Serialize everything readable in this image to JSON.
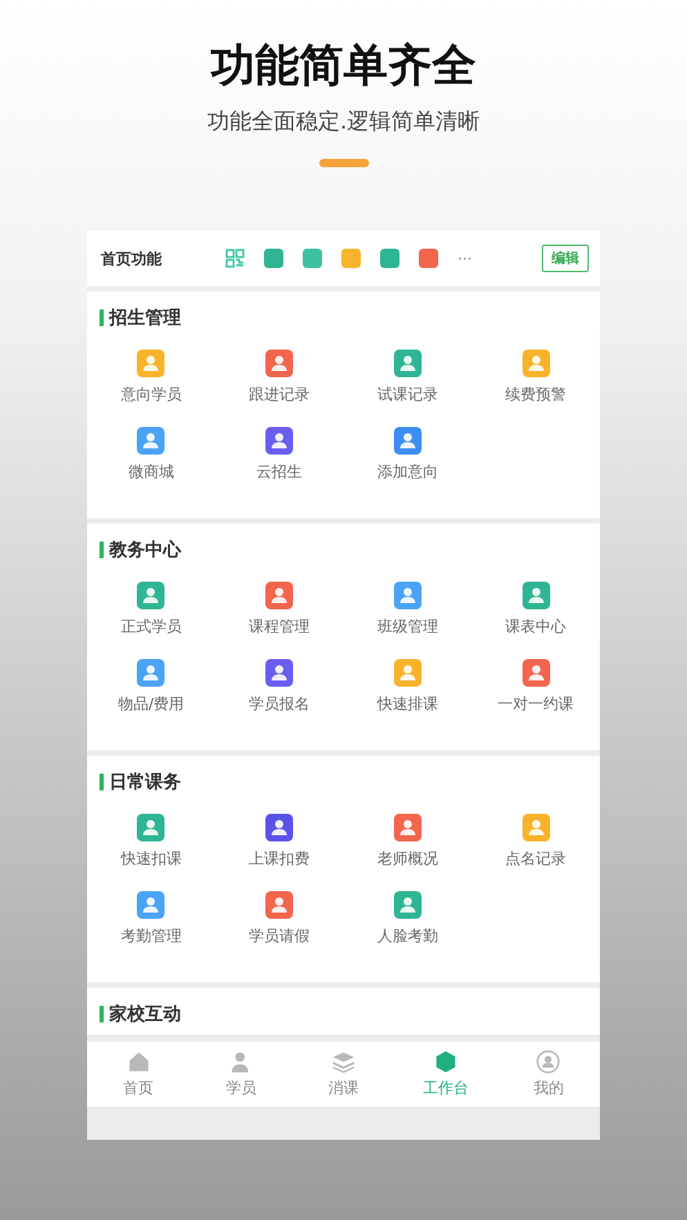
{
  "headline": "功能简单齐全",
  "subtitle": "功能全面稳定.逻辑简单清晰",
  "header": {
    "title": "首页功能",
    "icons": [
      {
        "color": "#3cc9a8",
        "kind": "qr"
      },
      {
        "color": "#2fb593",
        "kind": "tile"
      },
      {
        "color": "#3cc2a0",
        "kind": "tile"
      },
      {
        "color": "#f7b52c",
        "kind": "tile"
      },
      {
        "color": "#2fb593",
        "kind": "tile"
      },
      {
        "color": "#f3654d",
        "kind": "tile"
      }
    ],
    "more": "···",
    "edit_button": "编辑"
  },
  "sections": [
    {
      "title": "招生管理",
      "items": [
        {
          "label": "意向学员",
          "color": "#f9b32a"
        },
        {
          "label": "跟进记录",
          "color": "#f3654d"
        },
        {
          "label": "试课记录",
          "color": "#2fb593"
        },
        {
          "label": "续费预警",
          "color": "#f9b32a"
        },
        {
          "label": "微商城",
          "color": "#4ba3f5"
        },
        {
          "label": "云招生",
          "color": "#6a5ef0"
        },
        {
          "label": "添加意向",
          "color": "#3d8ef2"
        }
      ]
    },
    {
      "title": "教务中心",
      "items": [
        {
          "label": "正式学员",
          "color": "#2fb593"
        },
        {
          "label": "课程管理",
          "color": "#f3654d"
        },
        {
          "label": "班级管理",
          "color": "#4ba3f5"
        },
        {
          "label": "课表中心",
          "color": "#2fb593"
        },
        {
          "label": "物品/费用",
          "color": "#4ba3f5"
        },
        {
          "label": "学员报名",
          "color": "#6a5ef0"
        },
        {
          "label": "快速排课",
          "color": "#f9b32a"
        },
        {
          "label": "一对一约课",
          "color": "#f3654d"
        }
      ]
    },
    {
      "title": "日常课务",
      "items": [
        {
          "label": "快速扣课",
          "color": "#2fb593"
        },
        {
          "label": "上课扣费",
          "color": "#5a52e8"
        },
        {
          "label": "老师概况",
          "color": "#f3654d"
        },
        {
          "label": "点名记录",
          "color": "#f9b32a"
        },
        {
          "label": "考勤管理",
          "color": "#4ba3f5"
        },
        {
          "label": "学员请假",
          "color": "#f3654d"
        },
        {
          "label": "人脸考勤",
          "color": "#2fb593"
        }
      ]
    },
    {
      "title": "家校互动"
    }
  ],
  "tabbar": [
    {
      "label": "首页",
      "selected": false,
      "kind": "home"
    },
    {
      "label": "学员",
      "selected": false,
      "kind": "person"
    },
    {
      "label": "消课",
      "selected": false,
      "kind": "layers"
    },
    {
      "label": "工作台",
      "selected": true,
      "kind": "hex"
    },
    {
      "label": "我的",
      "selected": false,
      "kind": "avatar"
    }
  ]
}
